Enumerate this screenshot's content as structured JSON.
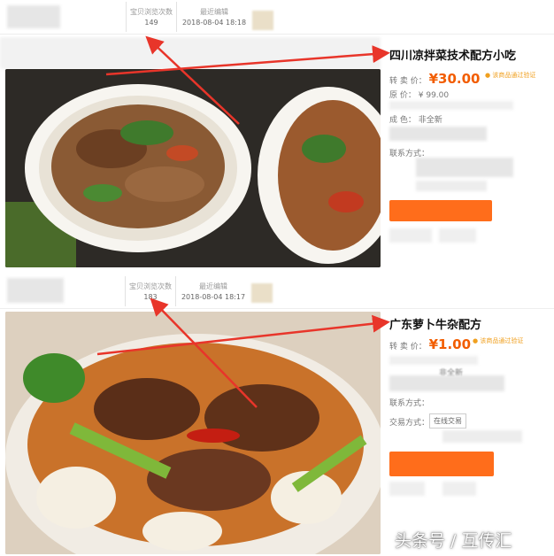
{
  "listing1": {
    "stat_label": "宝贝浏览次数",
    "stat_value": "149",
    "date_label": "最近编辑",
    "date_value": "2018-08-04 18:18",
    "title": "四川凉拌菜技术配方小吃",
    "price_label": "转 卖 价：",
    "price_symbol": "¥",
    "price_value": "30.00",
    "verify_text": "该商品通过验证",
    "orig_label": "原    价：",
    "orig_value": "¥ 99.00",
    "condition_label": "成    色：",
    "condition_value": "非全新",
    "contact_label": "联系方式："
  },
  "listing2": {
    "stat_label": "宝贝浏览次数",
    "stat_value": "183",
    "date_label": "最近编辑",
    "date_value": "2018-08-04 18:17",
    "title": "广东萝卜牛杂配方",
    "price_label": "转 卖 价：",
    "price_symbol": "¥",
    "price_value": "1.00",
    "verify_text": "该商品通过验证",
    "condition_value": "非全新",
    "contact_label": "联系方式：",
    "trade_label": "交易方式：",
    "trade_value": "在线交易"
  },
  "watermark": "头条号 / 互传汇",
  "colors": {
    "accent": "#f25d00",
    "button": "#ff6d1b",
    "arrow": "#e8352a"
  }
}
